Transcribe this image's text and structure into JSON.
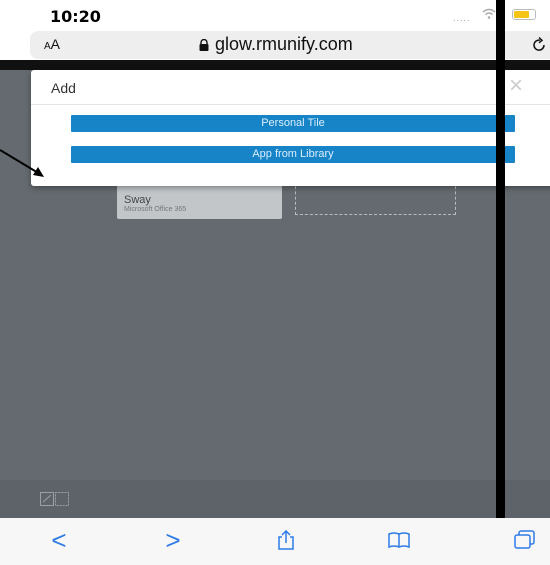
{
  "status_bar": {
    "time": "10:20",
    "signal": "....."
  },
  "address_bar": {
    "text_size_small": "A",
    "text_size_large": "A",
    "url": "glow.rmunify.com"
  },
  "tiles": [
    {
      "name": "Sway",
      "subtitle": "Microsoft Office 365"
    }
  ],
  "modal": {
    "title": "Add",
    "close": "×",
    "buttons": [
      {
        "label": "Personal Tile"
      },
      {
        "label": "App from Library"
      }
    ]
  },
  "toolbar": {
    "back": "<",
    "forward": ">"
  },
  "colors": {
    "button_blue": "#1784c7",
    "accent": "#2f7be7",
    "page_bg": "#646a6f"
  }
}
